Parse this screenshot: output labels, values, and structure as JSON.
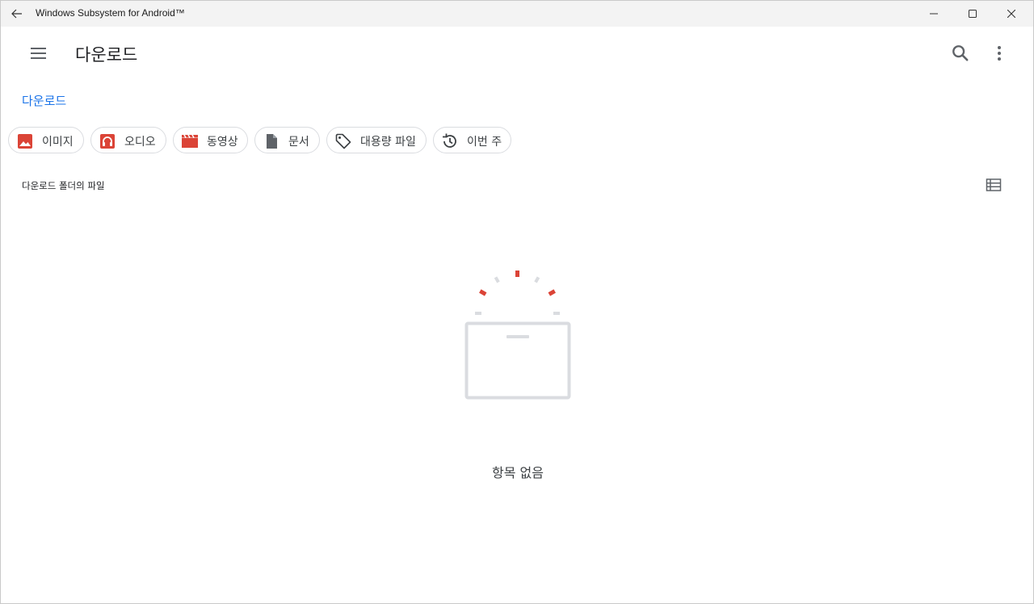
{
  "window": {
    "title": "Windows Subsystem for Android™"
  },
  "appbar": {
    "title": "다운로드"
  },
  "breadcrumb": {
    "current": "다운로드"
  },
  "chips": [
    {
      "label": "이미지",
      "icon": "image-icon"
    },
    {
      "label": "오디오",
      "icon": "headphones-icon"
    },
    {
      "label": "동영상",
      "icon": "movie-icon"
    },
    {
      "label": "문서",
      "icon": "document-icon"
    },
    {
      "label": "대용량 파일",
      "icon": "tag-icon"
    },
    {
      "label": "이번 주",
      "icon": "history-icon"
    }
  ],
  "section": {
    "title": "다운로드 폴더의 파일"
  },
  "empty_state": {
    "message": "항목 없음"
  },
  "colors": {
    "accent": "#1a73e8",
    "icon_red": "#db4437",
    "icon_grey": "#5f6368"
  }
}
